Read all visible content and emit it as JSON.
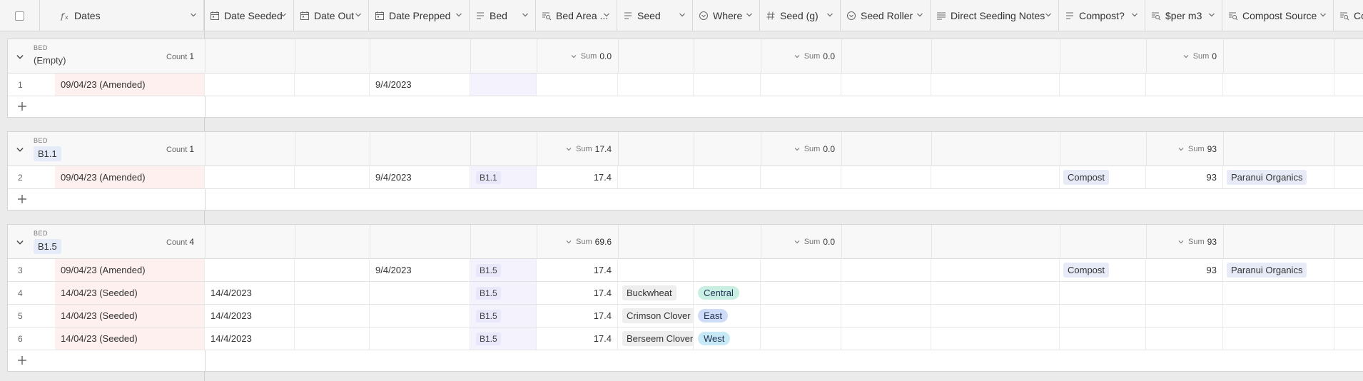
{
  "columns": [
    {
      "key": "dates",
      "title": "Dates",
      "icon": "formula-icon"
    },
    {
      "key": "date_seeded",
      "title": "Date Seeded",
      "icon": "calendar-icon"
    },
    {
      "key": "date_out",
      "title": "Date Out",
      "icon": "calendar-icon"
    },
    {
      "key": "date_prepped",
      "title": "Date Prepped",
      "icon": "calendar-icon"
    },
    {
      "key": "bed",
      "title": "Bed",
      "icon": "link-icon"
    },
    {
      "key": "bed_area",
      "title": "Bed Area ...",
      "icon": "lookup-icon"
    },
    {
      "key": "seed",
      "title": "Seed",
      "icon": "link-icon"
    },
    {
      "key": "where",
      "title": "Where",
      "icon": "single-select-icon"
    },
    {
      "key": "seed_g",
      "title": "Seed (g)",
      "icon": "number-icon"
    },
    {
      "key": "seed_roller",
      "title": "Seed Roller",
      "icon": "single-select-icon"
    },
    {
      "key": "direct_seeding_notes",
      "title": "Direct Seeding Notes",
      "icon": "long-text-icon"
    },
    {
      "key": "compost",
      "title": "Compost?",
      "icon": "link-icon"
    },
    {
      "key": "per_m3",
      "title": "$per m3",
      "icon": "lookup-icon"
    },
    {
      "key": "compost_source",
      "title": "Compost Source",
      "icon": "lookup-icon"
    },
    {
      "key": "co",
      "title": "Co",
      "icon": "lookup-icon"
    }
  ],
  "group_label": "BED",
  "count_label": "Count",
  "sum_label": "Sum",
  "groups": [
    {
      "name": "(Empty)",
      "count": "1",
      "sum_bed_area": "0.0",
      "sum_seed_g": "0.0",
      "sum_per_m3": "0",
      "rows": [
        {
          "n": "1",
          "dates": "09/04/23 (Amended)",
          "date_seeded": "",
          "date_prepped": "9/4/2023",
          "bed": "",
          "bed_area": "",
          "seed": "",
          "where": "",
          "compost": "",
          "per_m3": "",
          "compost_source": ""
        }
      ]
    },
    {
      "name": "B1.1",
      "count": "1",
      "sum_bed_area": "17.4",
      "sum_seed_g": "0.0",
      "sum_per_m3": "93",
      "rows": [
        {
          "n": "2",
          "dates": "09/04/23 (Amended)",
          "date_seeded": "",
          "date_prepped": "9/4/2023",
          "bed": "B1.1",
          "bed_area": "17.4",
          "seed": "",
          "where": "",
          "compost": "Compost",
          "per_m3": "93",
          "compost_source": "Paranui Organics"
        }
      ]
    },
    {
      "name": "B1.5",
      "count": "4",
      "sum_bed_area": "69.6",
      "sum_seed_g": "0.0",
      "sum_per_m3": "93",
      "rows": [
        {
          "n": "3",
          "dates": "09/04/23 (Amended)",
          "date_seeded": "",
          "date_prepped": "9/4/2023",
          "bed": "B1.5",
          "bed_area": "17.4",
          "seed": "",
          "where": "",
          "compost": "Compost",
          "per_m3": "93",
          "compost_source": "Paranui Organics"
        },
        {
          "n": "4",
          "dates": "14/04/23 (Seeded)",
          "date_seeded": "14/4/2023",
          "date_prepped": "",
          "bed": "B1.5",
          "bed_area": "17.4",
          "seed": "Buckwheat",
          "where": "Central",
          "compost": "",
          "per_m3": "",
          "compost_source": ""
        },
        {
          "n": "5",
          "dates": "14/04/23 (Seeded)",
          "date_seeded": "14/4/2023",
          "date_prepped": "",
          "bed": "B1.5",
          "bed_area": "17.4",
          "seed": "Crimson Clover",
          "where": "East",
          "compost": "",
          "per_m3": "",
          "compost_source": ""
        },
        {
          "n": "6",
          "dates": "14/04/23 (Seeded)",
          "date_seeded": "14/4/2023",
          "date_prepped": "",
          "bed": "B1.5",
          "bed_area": "17.4",
          "seed": "Berseem Clover",
          "where": "West",
          "compost": "",
          "per_m3": "",
          "compost_source": ""
        }
      ]
    }
  ],
  "colors": {
    "dates_bg": "#fdf0ee",
    "bed_bg": "#f3f2fd",
    "central": "#c9efe3",
    "east": "#cfdcf7",
    "west": "#c8e9f6"
  }
}
